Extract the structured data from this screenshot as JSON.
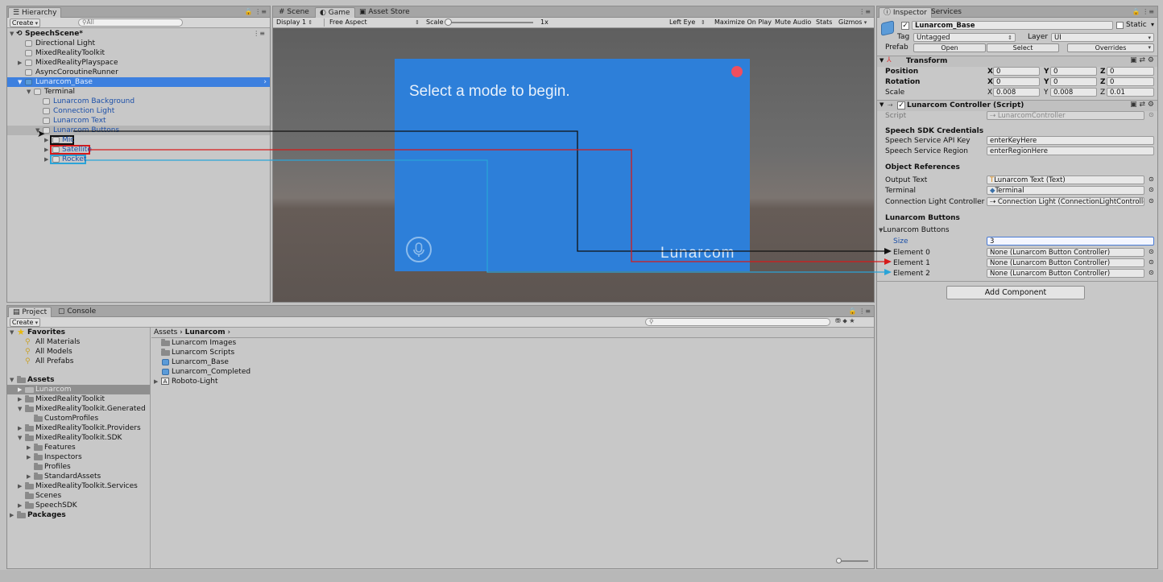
{
  "hierarchy": {
    "tab": "Hierarchy",
    "create_label": "Create",
    "search_placeholder": "All",
    "scene": "SpeechScene*",
    "items": [
      {
        "label": "Directional Light"
      },
      {
        "label": "MixedRealityToolkit"
      },
      {
        "label": "MixedRealityPlayspace"
      },
      {
        "label": "AsyncCoroutineRunner"
      },
      {
        "label": "Lunarcom_Base"
      },
      {
        "label": "Terminal"
      },
      {
        "label": "Lunarcom Background"
      },
      {
        "label": "Connection Light"
      },
      {
        "label": "Lunarcom Text"
      },
      {
        "label": "Lunarcom Buttons"
      },
      {
        "label": "Mic"
      },
      {
        "label": "Satellite"
      },
      {
        "label": "Rocket"
      }
    ]
  },
  "game_view": {
    "tabs": [
      {
        "label": "Scene"
      },
      {
        "label": "Game"
      },
      {
        "label": "Asset Store"
      }
    ],
    "display": "Display 1",
    "aspect": "Free Aspect",
    "scale_label": "Scale",
    "scale_value": "1x",
    "left_eye": "Left Eye",
    "maximize": "Maximize On Play",
    "mute": "Mute Audio",
    "stats": "Stats",
    "gizmos": "Gizmos",
    "prompt_text": "Select a mode to begin.",
    "brand_text": "Lunarcom",
    "panel_color": "#2d7fd9",
    "light_color": "#f04e5e"
  },
  "inspector": {
    "tabs": [
      {
        "label": "Inspector"
      },
      {
        "label": "Services"
      }
    ],
    "object_name": "Lunarcom_Base",
    "static_label": "Static",
    "tag_label": "Tag",
    "tag_value": "Untagged",
    "layer_label": "Layer",
    "layer_value": "UI",
    "prefab_label": "Prefab",
    "open": "Open",
    "select": "Select",
    "overrides": "Overrides",
    "transform": {
      "title": "Transform",
      "position_label": "Position",
      "rotation_label": "Rotation",
      "scale_label": "Scale",
      "x": "X",
      "y": "Y",
      "z": "Z",
      "position": [
        "0",
        "0",
        "0"
      ],
      "rotation": [
        "0",
        "0",
        "0"
      ],
      "scale": [
        "0.008",
        "0.008",
        "0.01"
      ]
    },
    "controller": {
      "title": "Lunarcom Controller (Script)",
      "script_label": "Script",
      "script_value": "LunarcomController",
      "speech_header": "Speech SDK Credentials",
      "api_key_label": "Speech Service API Key",
      "api_key_value": "enterKeyHere",
      "region_label": "Speech Service Region",
      "region_value": "enterRegionHere",
      "refs_header": "Object References",
      "output_label": "Output Text",
      "output_value": "Lunarcom Text (Text)",
      "terminal_label": "Terminal",
      "terminal_value": "Terminal",
      "conn_label": "Connection Light Controller",
      "conn_value": "Connection Light (ConnectionLightControlle",
      "buttons_header": "Lunarcom Buttons",
      "buttons_foldout": "Lunarcom Buttons",
      "size_label": "Size",
      "size_value": "3",
      "elements": [
        {
          "label": "Element 0",
          "value": "None (Lunarcom Button Controller)"
        },
        {
          "label": "Element 1",
          "value": "None (Lunarcom Button Controller)"
        },
        {
          "label": "Element 2",
          "value": "None (Lunarcom Button Controller)"
        }
      ]
    },
    "add_component": "Add Component"
  },
  "project": {
    "tabs": [
      {
        "label": "Project"
      },
      {
        "label": "Console"
      }
    ],
    "create_label": "Create",
    "favorites_label": "Favorites",
    "favorites": [
      {
        "label": "All Materials"
      },
      {
        "label": "All Models"
      },
      {
        "label": "All Prefabs"
      }
    ],
    "assets_label": "Assets",
    "tree": [
      {
        "label": "Lunarcom"
      },
      {
        "label": "MixedRealityToolkit"
      },
      {
        "label": "MixedRealityToolkit.Generated"
      },
      {
        "label": "CustomProfiles"
      },
      {
        "label": "MixedRealityToolkit.Providers"
      },
      {
        "label": "MixedRealityToolkit.SDK"
      },
      {
        "label": "Features"
      },
      {
        "label": "Inspectors"
      },
      {
        "label": "Profiles"
      },
      {
        "label": "StandardAssets"
      },
      {
        "label": "MixedRealityToolkit.Services"
      },
      {
        "label": "Scenes"
      },
      {
        "label": "SpeechSDK"
      }
    ],
    "packages_label": "Packages",
    "breadcrumb_root": "Assets",
    "breadcrumb_current": "Lunarcom",
    "files": [
      {
        "label": "Lunarcom Images"
      },
      {
        "label": "Lunarcom Scripts"
      },
      {
        "label": "Lunarcom_Base"
      },
      {
        "label": "Lunarcom_Completed"
      },
      {
        "label": "Roboto-Light"
      }
    ]
  }
}
